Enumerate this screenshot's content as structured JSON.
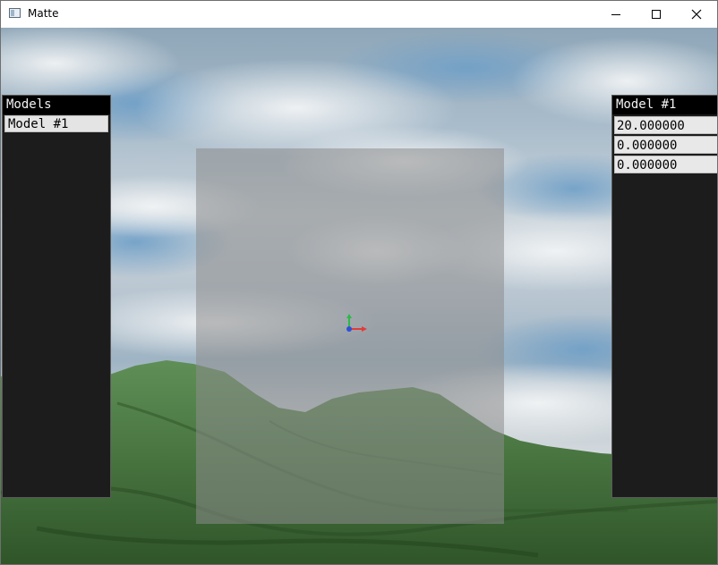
{
  "window": {
    "title": "Matte"
  },
  "titlebar": {
    "minimize_icon": "minimize-icon",
    "maximize_icon": "maximize-icon",
    "close_icon": "close-icon"
  },
  "models_panel": {
    "header": "Models",
    "items": [
      {
        "label": "Model #1"
      }
    ]
  },
  "properties_panel": {
    "header": "Model #1",
    "fields": [
      {
        "value": "20.000000"
      },
      {
        "value": "0.000000"
      },
      {
        "value": "0.000000"
      }
    ]
  },
  "viewport": {
    "gizmo_axis_colors": {
      "x": "#e23b3b",
      "y": "#2fb84a",
      "z": "#2f4fd8"
    },
    "matte_color": "#8c8c8c",
    "terrain_color": "#4e7a48"
  }
}
